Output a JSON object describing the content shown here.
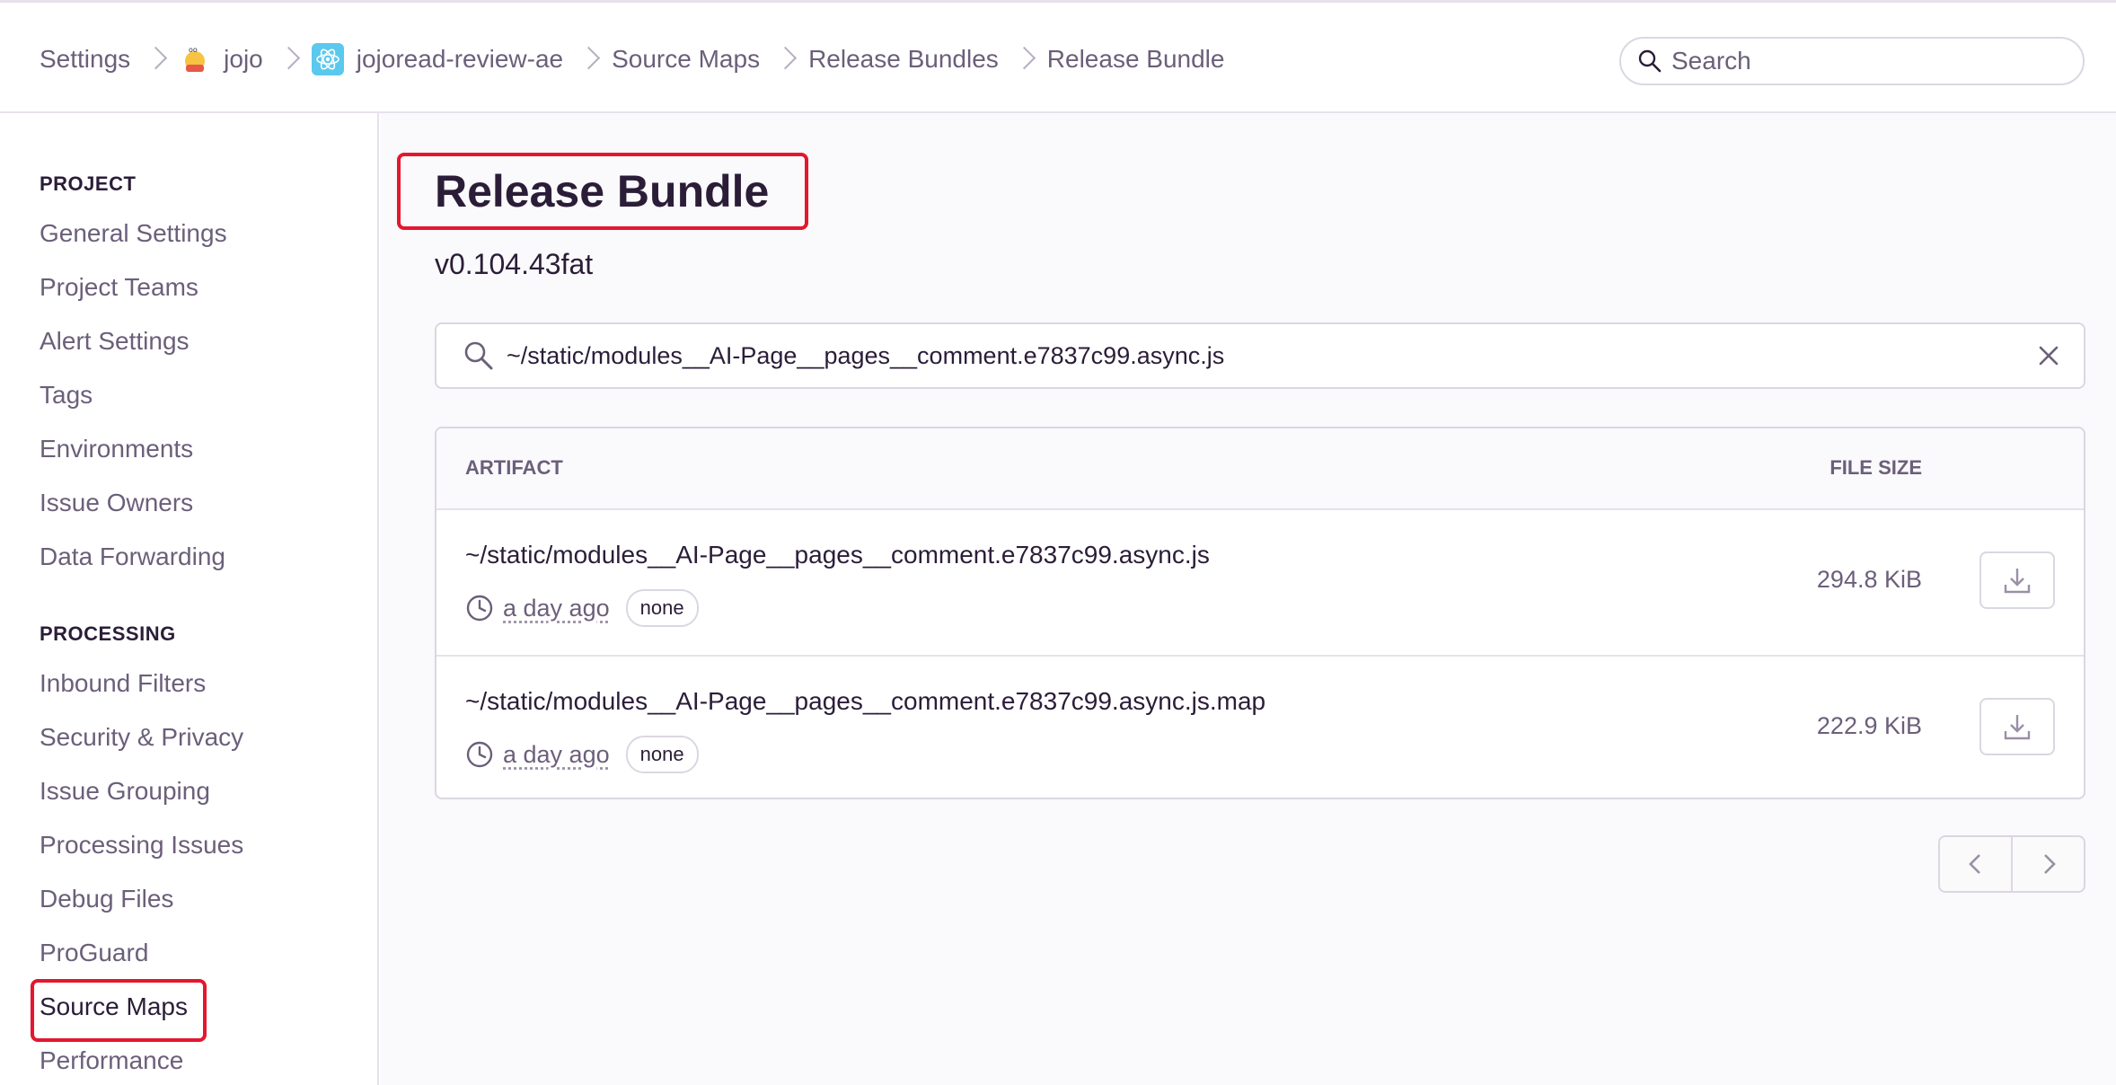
{
  "breadcrumb": {
    "items": [
      "Settings",
      "jojo",
      "jojoread-review-ae",
      "Source Maps",
      "Release Bundles",
      "Release Bundle"
    ]
  },
  "search": {
    "placeholder": "Search"
  },
  "sidebar": {
    "project_heading": "PROJECT",
    "project_items": [
      "General Settings",
      "Project Teams",
      "Alert Settings",
      "Tags",
      "Environments",
      "Issue Owners",
      "Data Forwarding"
    ],
    "processing_heading": "PROCESSING",
    "processing_items": [
      "Inbound Filters",
      "Security & Privacy",
      "Issue Grouping",
      "Processing Issues",
      "Debug Files",
      "ProGuard",
      "Source Maps",
      "Performance"
    ],
    "active_item": "Source Maps"
  },
  "page": {
    "title": "Release Bundle",
    "version": "v0.104.43fat"
  },
  "filter": {
    "value": "~/static/modules__AI-Page__pages__comment.e7837c99.async.js"
  },
  "table": {
    "headers": {
      "artifact": "ARTIFACT",
      "file_size": "FILE SIZE"
    },
    "rows": [
      {
        "name": "~/static/modules__AI-Page__pages__comment.e7837c99.async.js",
        "time": "a day ago",
        "dist": "none",
        "size": "294.8 KiB"
      },
      {
        "name": "~/static/modules__AI-Page__pages__comment.e7837c99.async.js.map",
        "time": "a day ago",
        "dist": "none",
        "size": "222.9 KiB"
      }
    ]
  },
  "colors": {
    "highlight": "#e3172e",
    "text": "#2b1d38",
    "muted": "#6b5f7a"
  }
}
